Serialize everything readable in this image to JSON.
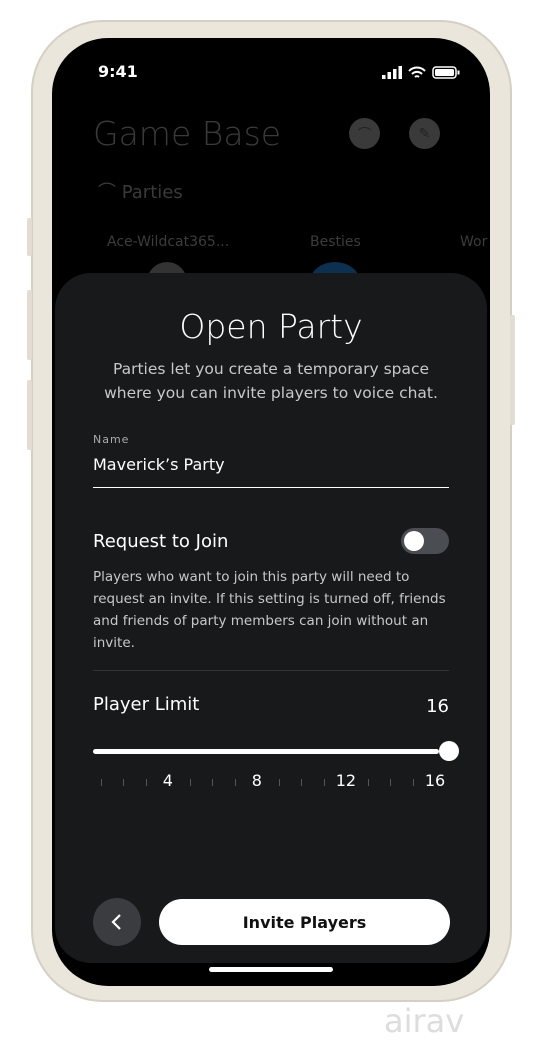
{
  "status_bar": {
    "time": "9:41"
  },
  "background": {
    "title": "Game Base",
    "section": "Parties",
    "chips": [
      "Ace-Wildcat365...",
      "Besties",
      "Wor"
    ]
  },
  "sheet": {
    "title": "Open Party",
    "subtitle": "Parties let you create a temporary space where you can invite players to voice chat.",
    "name_label": "Name",
    "name_value": "Maverick’s Party",
    "request_to_join": {
      "label": "Request to Join",
      "enabled": false,
      "description": "Players who want to join this party will need to request an invite. If this setting is turned off, friends and friends of party members can join without an invite."
    },
    "player_limit": {
      "label": "Player Limit",
      "value": "16",
      "min": 1,
      "max": 16,
      "tick_labels": [
        "4",
        "8",
        "12",
        "16"
      ]
    },
    "invite_button": "Invite Players"
  },
  "watermark": "airav"
}
